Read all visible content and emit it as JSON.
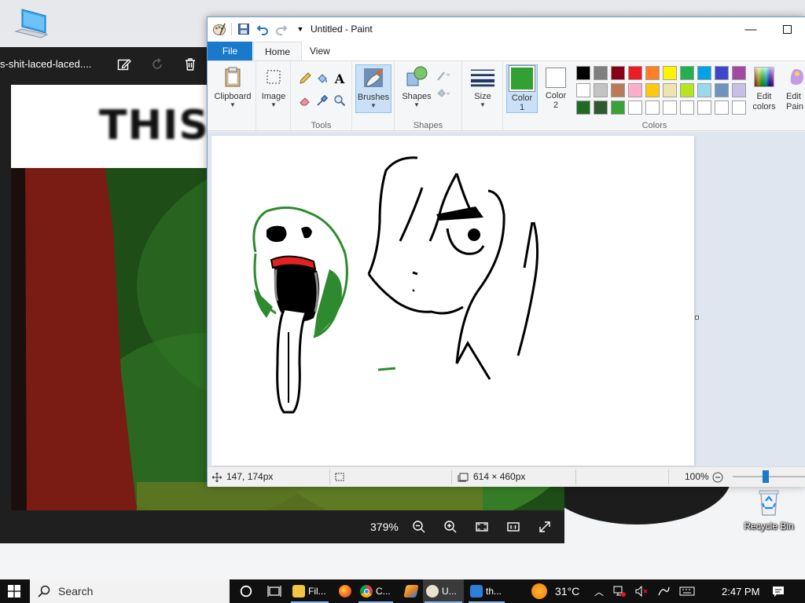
{
  "desktop": {
    "recycle_bin_label": "Recycle Bin"
  },
  "viewer": {
    "file_name": "s-shit-laced-laced....",
    "banner_text": "THIS S",
    "zoom": "379%"
  },
  "paint": {
    "title": "Untitled - Paint",
    "tabs": {
      "file": "File",
      "home": "Home",
      "view": "View"
    },
    "ribbon": {
      "clipboard": "Clipboard",
      "image": "Image",
      "tools": "Tools",
      "brushes": "Brushes",
      "shapes_btn": "Shapes",
      "shapes_group": "Shapes",
      "size": "Size",
      "color1": "Color",
      "color1_num": "1",
      "color2": "Color",
      "color2_num": "2",
      "colors_group": "Colors",
      "edit_colors_1": "Edit",
      "edit_colors_2": "colors",
      "paint3d_1": "Edit",
      "paint3d_2": "Pain"
    },
    "colors": {
      "color1": "#32a032",
      "color2": "#ffffff",
      "palette_row1": [
        "#000000",
        "#7f7f7f",
        "#880015",
        "#ed1c24",
        "#ff7f27",
        "#fff200",
        "#22b14c",
        "#00a2e8",
        "#3f48cc",
        "#a349a4"
      ],
      "palette_row2": [
        "#ffffff",
        "#c3c3c3",
        "#b97a57",
        "#ffaec9",
        "#ffc90e",
        "#efe4b0",
        "#b5e61d",
        "#99d9ea",
        "#7092be",
        "#c8bfe7"
      ],
      "palette_row3": [
        "#1f6b24",
        "#2f5a2f",
        "#3aa13a",
        "#ffffff",
        "#ffffff",
        "#ffffff",
        "#ffffff",
        "#ffffff",
        "#ffffff",
        "#ffffff"
      ]
    },
    "status": {
      "cursor_pos": "147, 174px",
      "canvas_size": "614 × 460px",
      "zoom": "100%"
    }
  },
  "taskbar": {
    "search_placeholder": "Search",
    "items": [
      {
        "label": "Fil..."
      },
      {
        "label": "C..."
      },
      {
        "label": "U..."
      },
      {
        "label": "th..."
      }
    ],
    "weather": "31°C",
    "time": "2:47 PM"
  }
}
